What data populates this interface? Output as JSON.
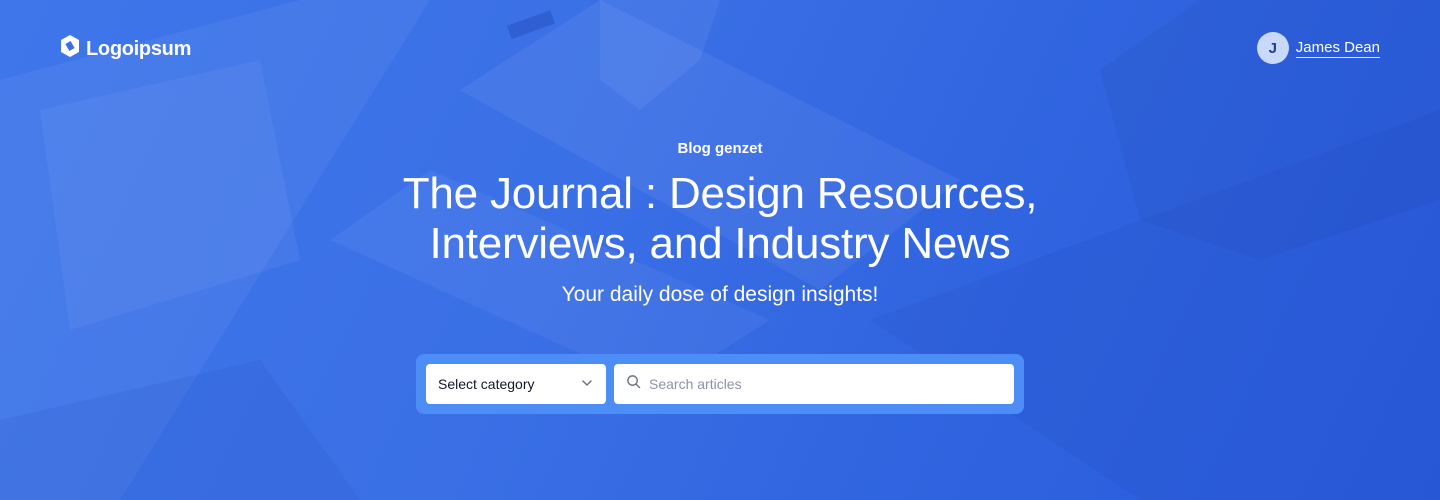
{
  "brand": {
    "name": "Logoipsum",
    "icon": "logo-mark-icon"
  },
  "user": {
    "initial": "J",
    "name": "James Dean"
  },
  "hero": {
    "eyebrow": "Blog genzet",
    "title_line1": "The Journal : Design Resources,",
    "title_line2": "Interviews, and Industry News",
    "subtitle": "Your daily dose of design insights!"
  },
  "filters": {
    "category_selected": "Select category",
    "search_placeholder": "Search articles",
    "search_value": ""
  },
  "colors": {
    "background": "#3a6fe6",
    "panel": "#4d8df6",
    "text": "#ffffff"
  }
}
